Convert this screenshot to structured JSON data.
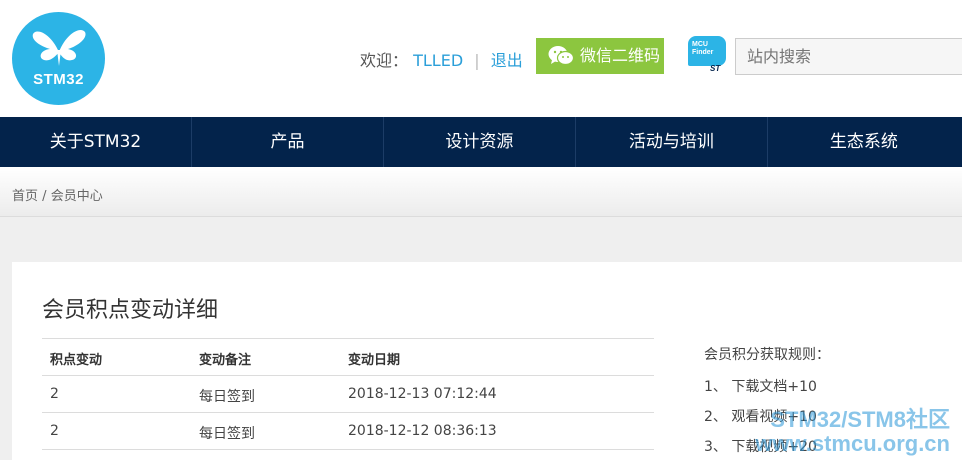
{
  "header": {
    "logo_text": "STM32",
    "welcome_label": "欢迎：",
    "username": "TLLED",
    "separator": "|",
    "logout": "退出",
    "wechat_button": "微信二维码",
    "mcu_finder_line1": "MCU",
    "mcu_finder_line2": "Finder",
    "st_mark": "ST",
    "search_placeholder": "站内搜索"
  },
  "nav": {
    "items": [
      "关于STM32",
      "产品",
      "设计资源",
      "活动与培训",
      "生态系统"
    ]
  },
  "breadcrumb": {
    "home": "首页",
    "divider": "/",
    "current": "会员中心"
  },
  "main": {
    "title": "会员积点变动详细",
    "table": {
      "headers": [
        "积点变动",
        "变动备注",
        "变动日期"
      ],
      "rows": [
        [
          "2",
          "每日签到",
          "2018-12-13 07:12:44"
        ],
        [
          "2",
          "每日签到",
          "2018-12-12 08:36:13"
        ]
      ]
    },
    "rules": {
      "title": "会员积分获取规则：",
      "items": [
        "1、 下载文档+10",
        "2、 观看视频+10",
        "3、 下载视频+20"
      ]
    }
  },
  "watermark": {
    "line1": "STM32/STM8社区",
    "line2": "www.stmcu.org.cn"
  },
  "colors": {
    "nav_bg": "#03234b",
    "logo_blue": "#2cb4e6",
    "wechat_green": "#8cc63f",
    "link_blue": "#2b9fd9"
  }
}
